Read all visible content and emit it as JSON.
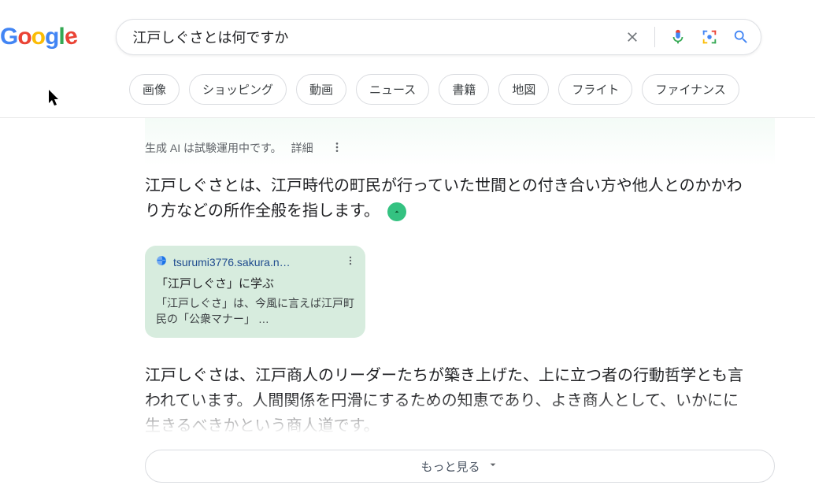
{
  "search": {
    "query": "江戸しぐさとは何ですか"
  },
  "chips": [
    "画像",
    "ショッピング",
    "動画",
    "ニュース",
    "書籍",
    "地図",
    "フライト",
    "ファイナンス"
  ],
  "ai": {
    "notice": "生成 AI は試験運用中です。",
    "more_label": "詳細",
    "summary": "江戸しぐさとは、江戸時代の町民が行っていた世間との付き合い方や他人とのかかわり方などの所作全般を指します。",
    "citation": {
      "domain": "tsurumi3776.sakura.n…",
      "title": "「江戸しぐさ」に学ぶ",
      "snippet": "「江戸しぐさ」は、今風に言えば江戸町民の「公衆マナー」 …"
    },
    "para2": "江戸しぐさは、江戸商人のリーダーたちが築き上げた、上に立つ者の行動哲学とも言われています。人間関係を円滑にするための知恵であり、よき商人として、いかにに生きるべきかという商人道です。",
    "show_more": "もっと見る"
  }
}
